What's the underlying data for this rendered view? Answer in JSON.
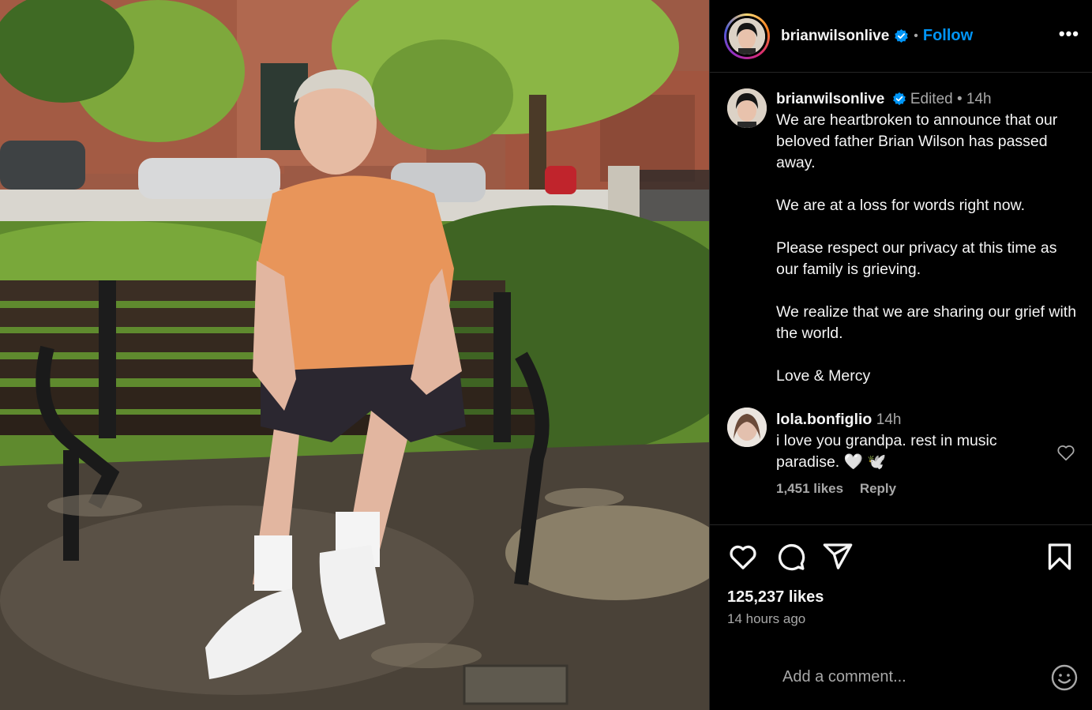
{
  "header": {
    "username": "brianwilsonlive",
    "separator": "•",
    "follow_label": "Follow",
    "more_label": "•••"
  },
  "caption": {
    "username": "brianwilsonlive",
    "edited_label": "Edited",
    "separator": "•",
    "time": "14h",
    "text": "We are heartbroken to announce that our beloved father Brian Wilson has passed away.\n\nWe are at a loss for words right now.\n\nPlease respect our privacy at this time as our family is grieving.\n\nWe realize that we are sharing our grief with the world.\n\nLove & Mercy"
  },
  "comment": {
    "username": "lola.bonfiglio",
    "time": "14h",
    "text": "i love you grandpa. rest in music paradise. 🤍 🕊️",
    "likes": "1,451 likes",
    "reply_label": "Reply"
  },
  "post": {
    "likes": "125,237 likes",
    "time_ago": "14 hours ago"
  },
  "add_comment": {
    "placeholder": "Add a comment..."
  },
  "colors": {
    "accent": "#0095f6",
    "verified": "#0095f6",
    "background": "#000000",
    "secondary_text": "#a8a8a8"
  },
  "icons": [
    "verified-icon",
    "more-icon",
    "heart-icon",
    "comment-icon",
    "share-icon",
    "bookmark-icon",
    "emoji-icon"
  ]
}
